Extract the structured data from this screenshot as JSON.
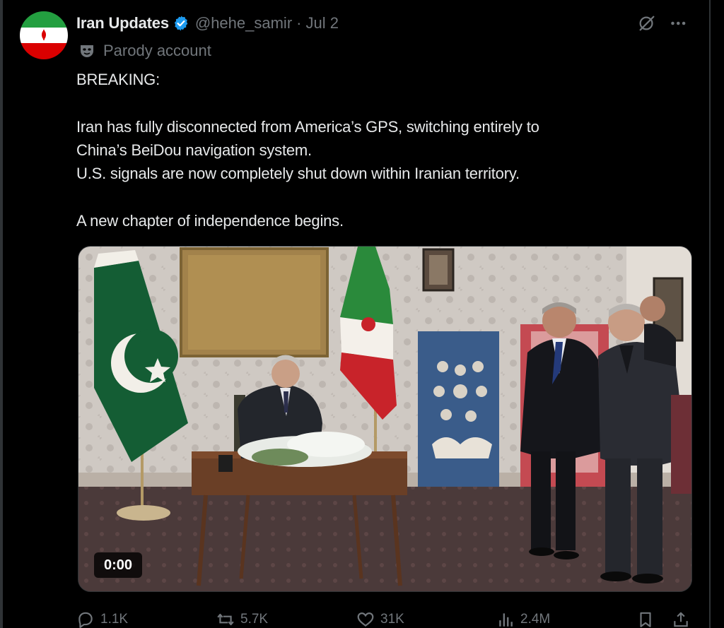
{
  "tweet": {
    "display_name": "Iran Updates",
    "handle": "@hehe_samir",
    "separator": "·",
    "date": "Jul 2",
    "parody_label": "Parody account",
    "text_lines": [
      "BREAKING:",
      "Iran has fully disconnected from America’s GPS, switching entirely to",
      "China’s BeiDou navigation system.",
      "U.S. signals are now completely shut down within Iranian territory.",
      "A new chapter of independence begins."
    ],
    "media": {
      "timestamp": "0:00"
    },
    "actions": {
      "replies": "1.1K",
      "reposts": "5.7K",
      "likes": "31K",
      "views": "2.4M"
    }
  },
  "icons": {
    "verified": "verified-badge-icon",
    "parody": "parody-mask-icon",
    "grok": "grok-icon",
    "more": "more-icon",
    "reply": "reply-icon",
    "repost": "repost-icon",
    "like": "like-icon",
    "views": "views-icon",
    "bookmark": "bookmark-icon",
    "share": "share-icon"
  },
  "colors": {
    "background": "#000000",
    "text": "#e7e9ea",
    "secondary": "#71767b",
    "verified": "#1d9bf0",
    "border": "#2f3336"
  }
}
